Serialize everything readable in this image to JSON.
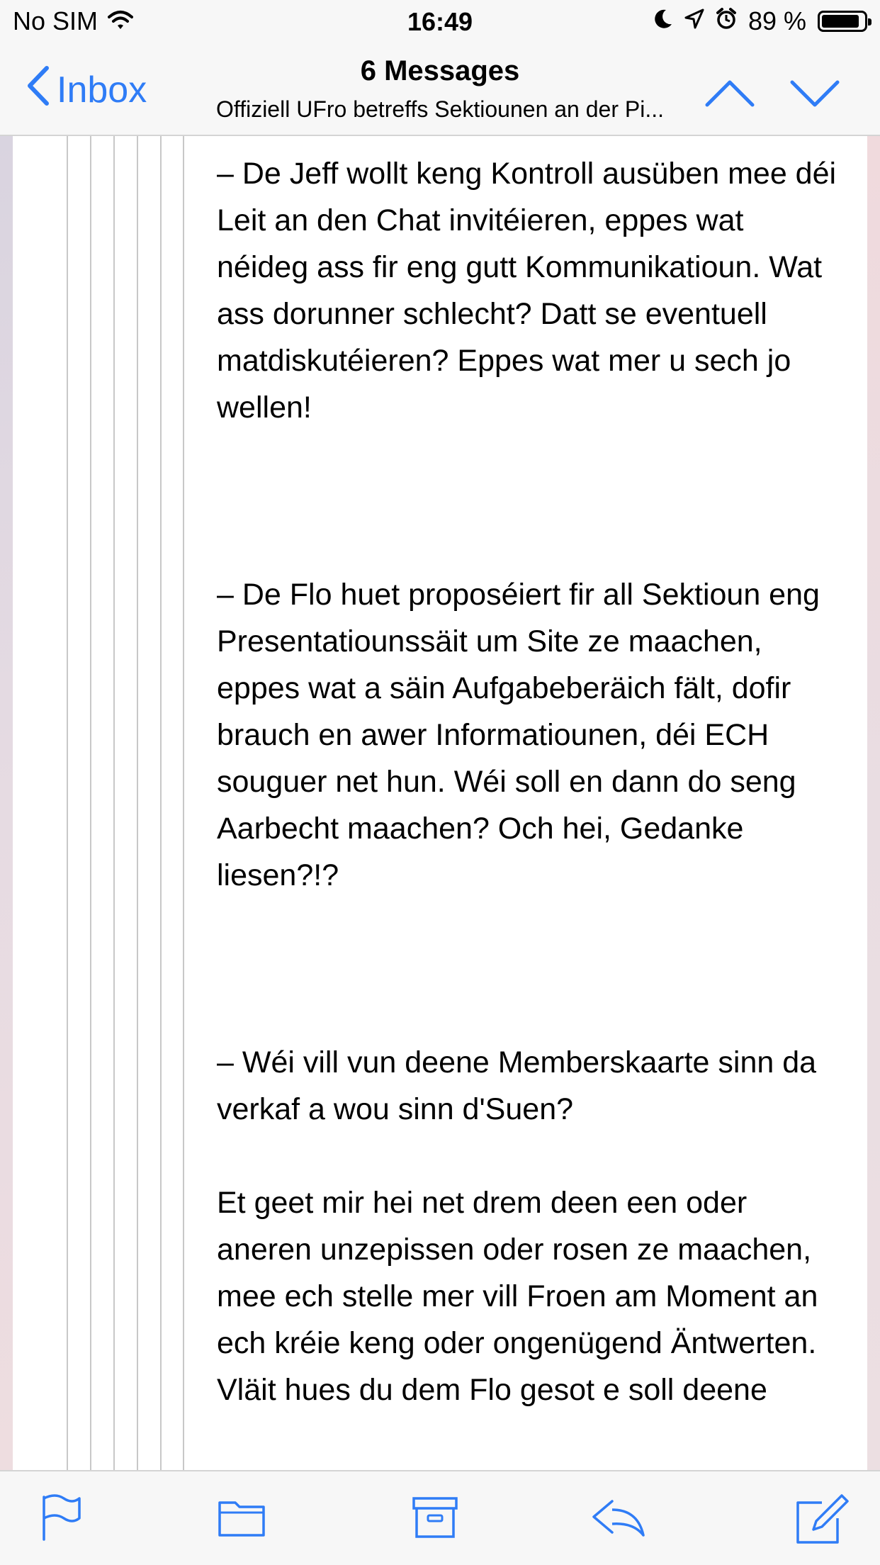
{
  "status_bar": {
    "carrier": "No SIM",
    "time": "16:49",
    "battery_text": "89 %",
    "battery_level": 0.89,
    "icons": [
      "wifi-icon",
      "moon-icon",
      "location-arrow-icon",
      "alarm-icon",
      "battery-icon"
    ]
  },
  "nav": {
    "back_label": "Inbox",
    "title": "6 Messages",
    "subtitle": "Offiziell UFro betreffs Sektiounen an der Pi...",
    "icons": [
      "chevron-left-icon",
      "chevron-up-icon",
      "chevron-down-icon"
    ]
  },
  "message": {
    "paragraphs": [
      "– De Jeff wollt keng Kontroll ausüben mee déi Leit an den Chat invitéieren, eppes wat néideg ass fir eng gutt Kommunikatioun. Wat ass dorunner schlecht? Datt se eventuell matdiskutéieren? Eppes wat mer u sech jo wellen!",
      "– De Flo huet proposéiert fir all Sektioun eng Presentatiounssäit um Site ze maachen, eppes wat a säin Aufgabeberäich fält, dofir brauch en awer Informatiounen, déi ECH souguer net hun. Wéi soll en dann do seng Aarbecht maachen? Och hei, Gedanke liesen?!?",
      "– Wéi vill vun deene Memberskaarte sinn da verkaf a wou sinn d'Suen?",
      "Et geet mir hei net drem deen een oder aneren unzepissen oder rosen ze maachen, mee ech stelle mer vill Froen am Moment an ech kréie keng oder ongenügend Äntwerten. Vläit hues du dem Flo gesot e soll deene"
    ]
  },
  "toolbar": {
    "icons": [
      "flag-icon",
      "folder-icon",
      "archive-icon",
      "reply-icon",
      "compose-icon"
    ]
  },
  "colors": {
    "accent": "#2f7cf6",
    "bar_background": "#f7f7f7",
    "quote_line": "#c8c8c8"
  }
}
